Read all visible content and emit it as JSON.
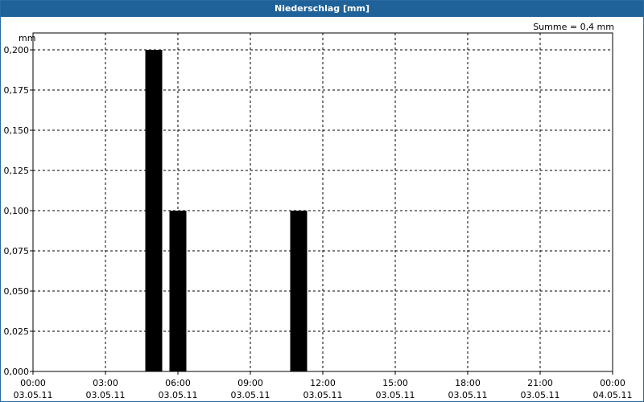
{
  "window": {
    "title": "Niederschlag [mm]"
  },
  "summary": {
    "text": "Summe = 0,4 mm"
  },
  "chart_data": {
    "type": "bar",
    "title": "Niederschlag [mm]",
    "ylabel": "mm",
    "xlabel": "",
    "ylim": [
      0,
      0.2
    ],
    "yticks": [
      "0,000",
      "0,025",
      "0,050",
      "0,075",
      "0,100",
      "0,125",
      "0,150",
      "0,175",
      "0,200"
    ],
    "xlim_hours": [
      0,
      24
    ],
    "xticks": [
      {
        "time": "00:00",
        "date": "03.05.11"
      },
      {
        "time": "03:00",
        "date": "03.05.11"
      },
      {
        "time": "06:00",
        "date": "03.05.11"
      },
      {
        "time": "09:00",
        "date": "03.05.11"
      },
      {
        "time": "12:00",
        "date": "03.05.11"
      },
      {
        "time": "15:00",
        "date": "03.05.11"
      },
      {
        "time": "18:00",
        "date": "03.05.11"
      },
      {
        "time": "21:00",
        "date": "03.05.11"
      },
      {
        "time": "00:00",
        "date": "04.05.11"
      }
    ],
    "bars": [
      {
        "time": "05:00",
        "value": 0.2
      },
      {
        "time": "06:00",
        "value": 0.1
      },
      {
        "time": "11:00",
        "value": 0.1
      }
    ],
    "bar_color": "#000000",
    "grid": true
  }
}
